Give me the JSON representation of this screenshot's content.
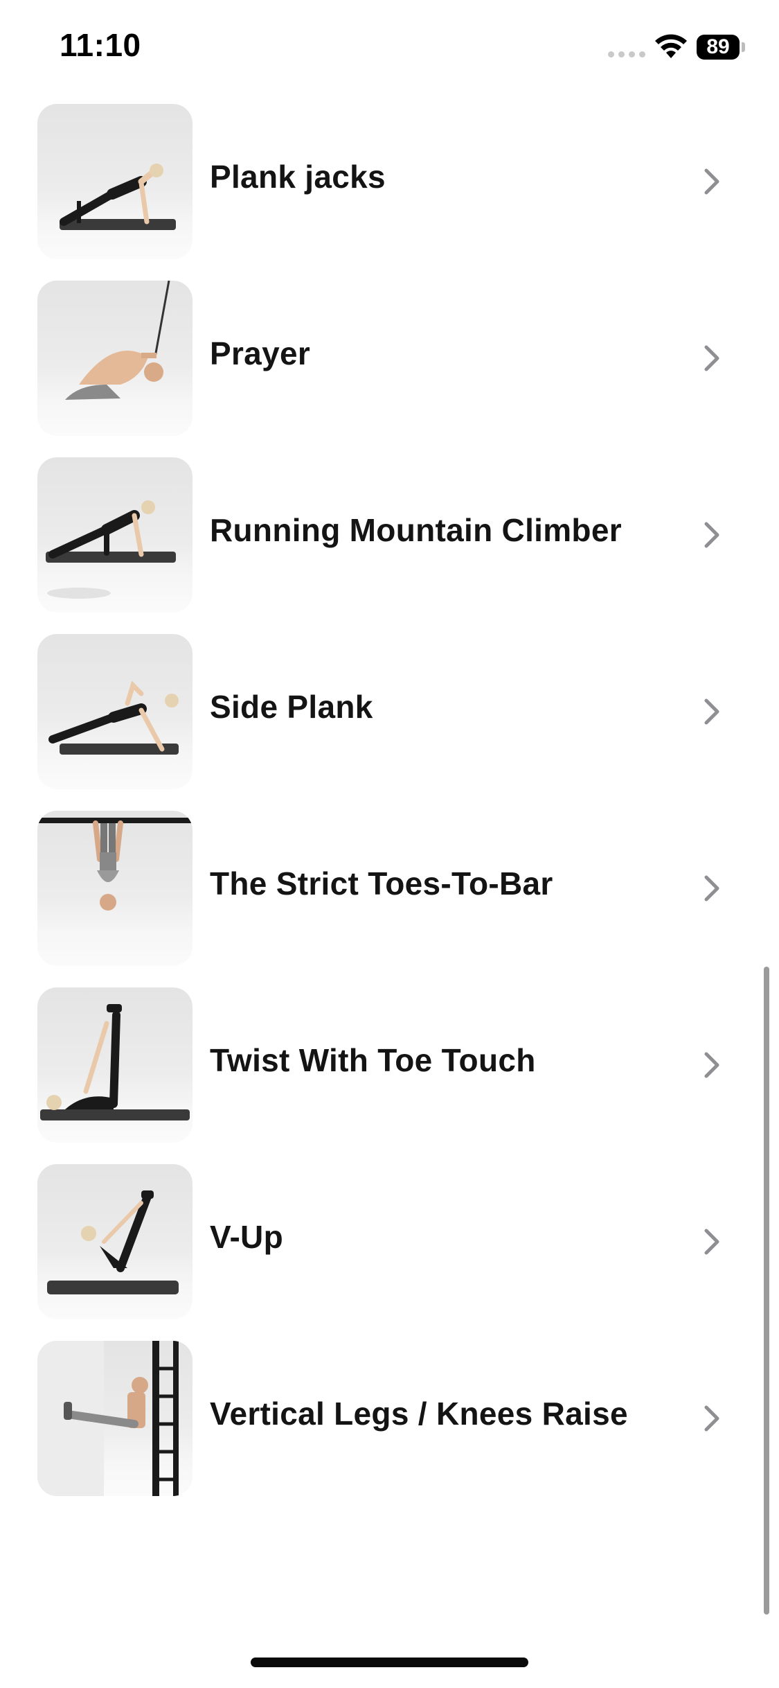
{
  "status_bar": {
    "time": "11:10",
    "battery": "89"
  },
  "exercises": [
    {
      "label": "Plank jacks",
      "thumb_icon": "plank-jacks-thumbnail"
    },
    {
      "label": "Prayer",
      "thumb_icon": "prayer-thumbnail"
    },
    {
      "label": "Running Mountain Climber",
      "thumb_icon": "running-mountain-climber-thumbnail"
    },
    {
      "label": "Side Plank",
      "thumb_icon": "side-plank-thumbnail"
    },
    {
      "label": "The Strict Toes-To-Bar",
      "thumb_icon": "strict-toes-to-bar-thumbnail"
    },
    {
      "label": "Twist With Toe Touch",
      "thumb_icon": "twist-with-toe-touch-thumbnail"
    },
    {
      "label": "V-Up",
      "thumb_icon": "v-up-thumbnail"
    },
    {
      "label": "Vertical Legs / Knees Raise",
      "thumb_icon": "vertical-legs-knees-raise-thumbnail"
    }
  ],
  "colors": {
    "background": "#ffffff",
    "label": "#141414",
    "chevron": "#8e8e93",
    "thumb_bg": "#e8e8e8",
    "mat": "#3a3a3a"
  }
}
